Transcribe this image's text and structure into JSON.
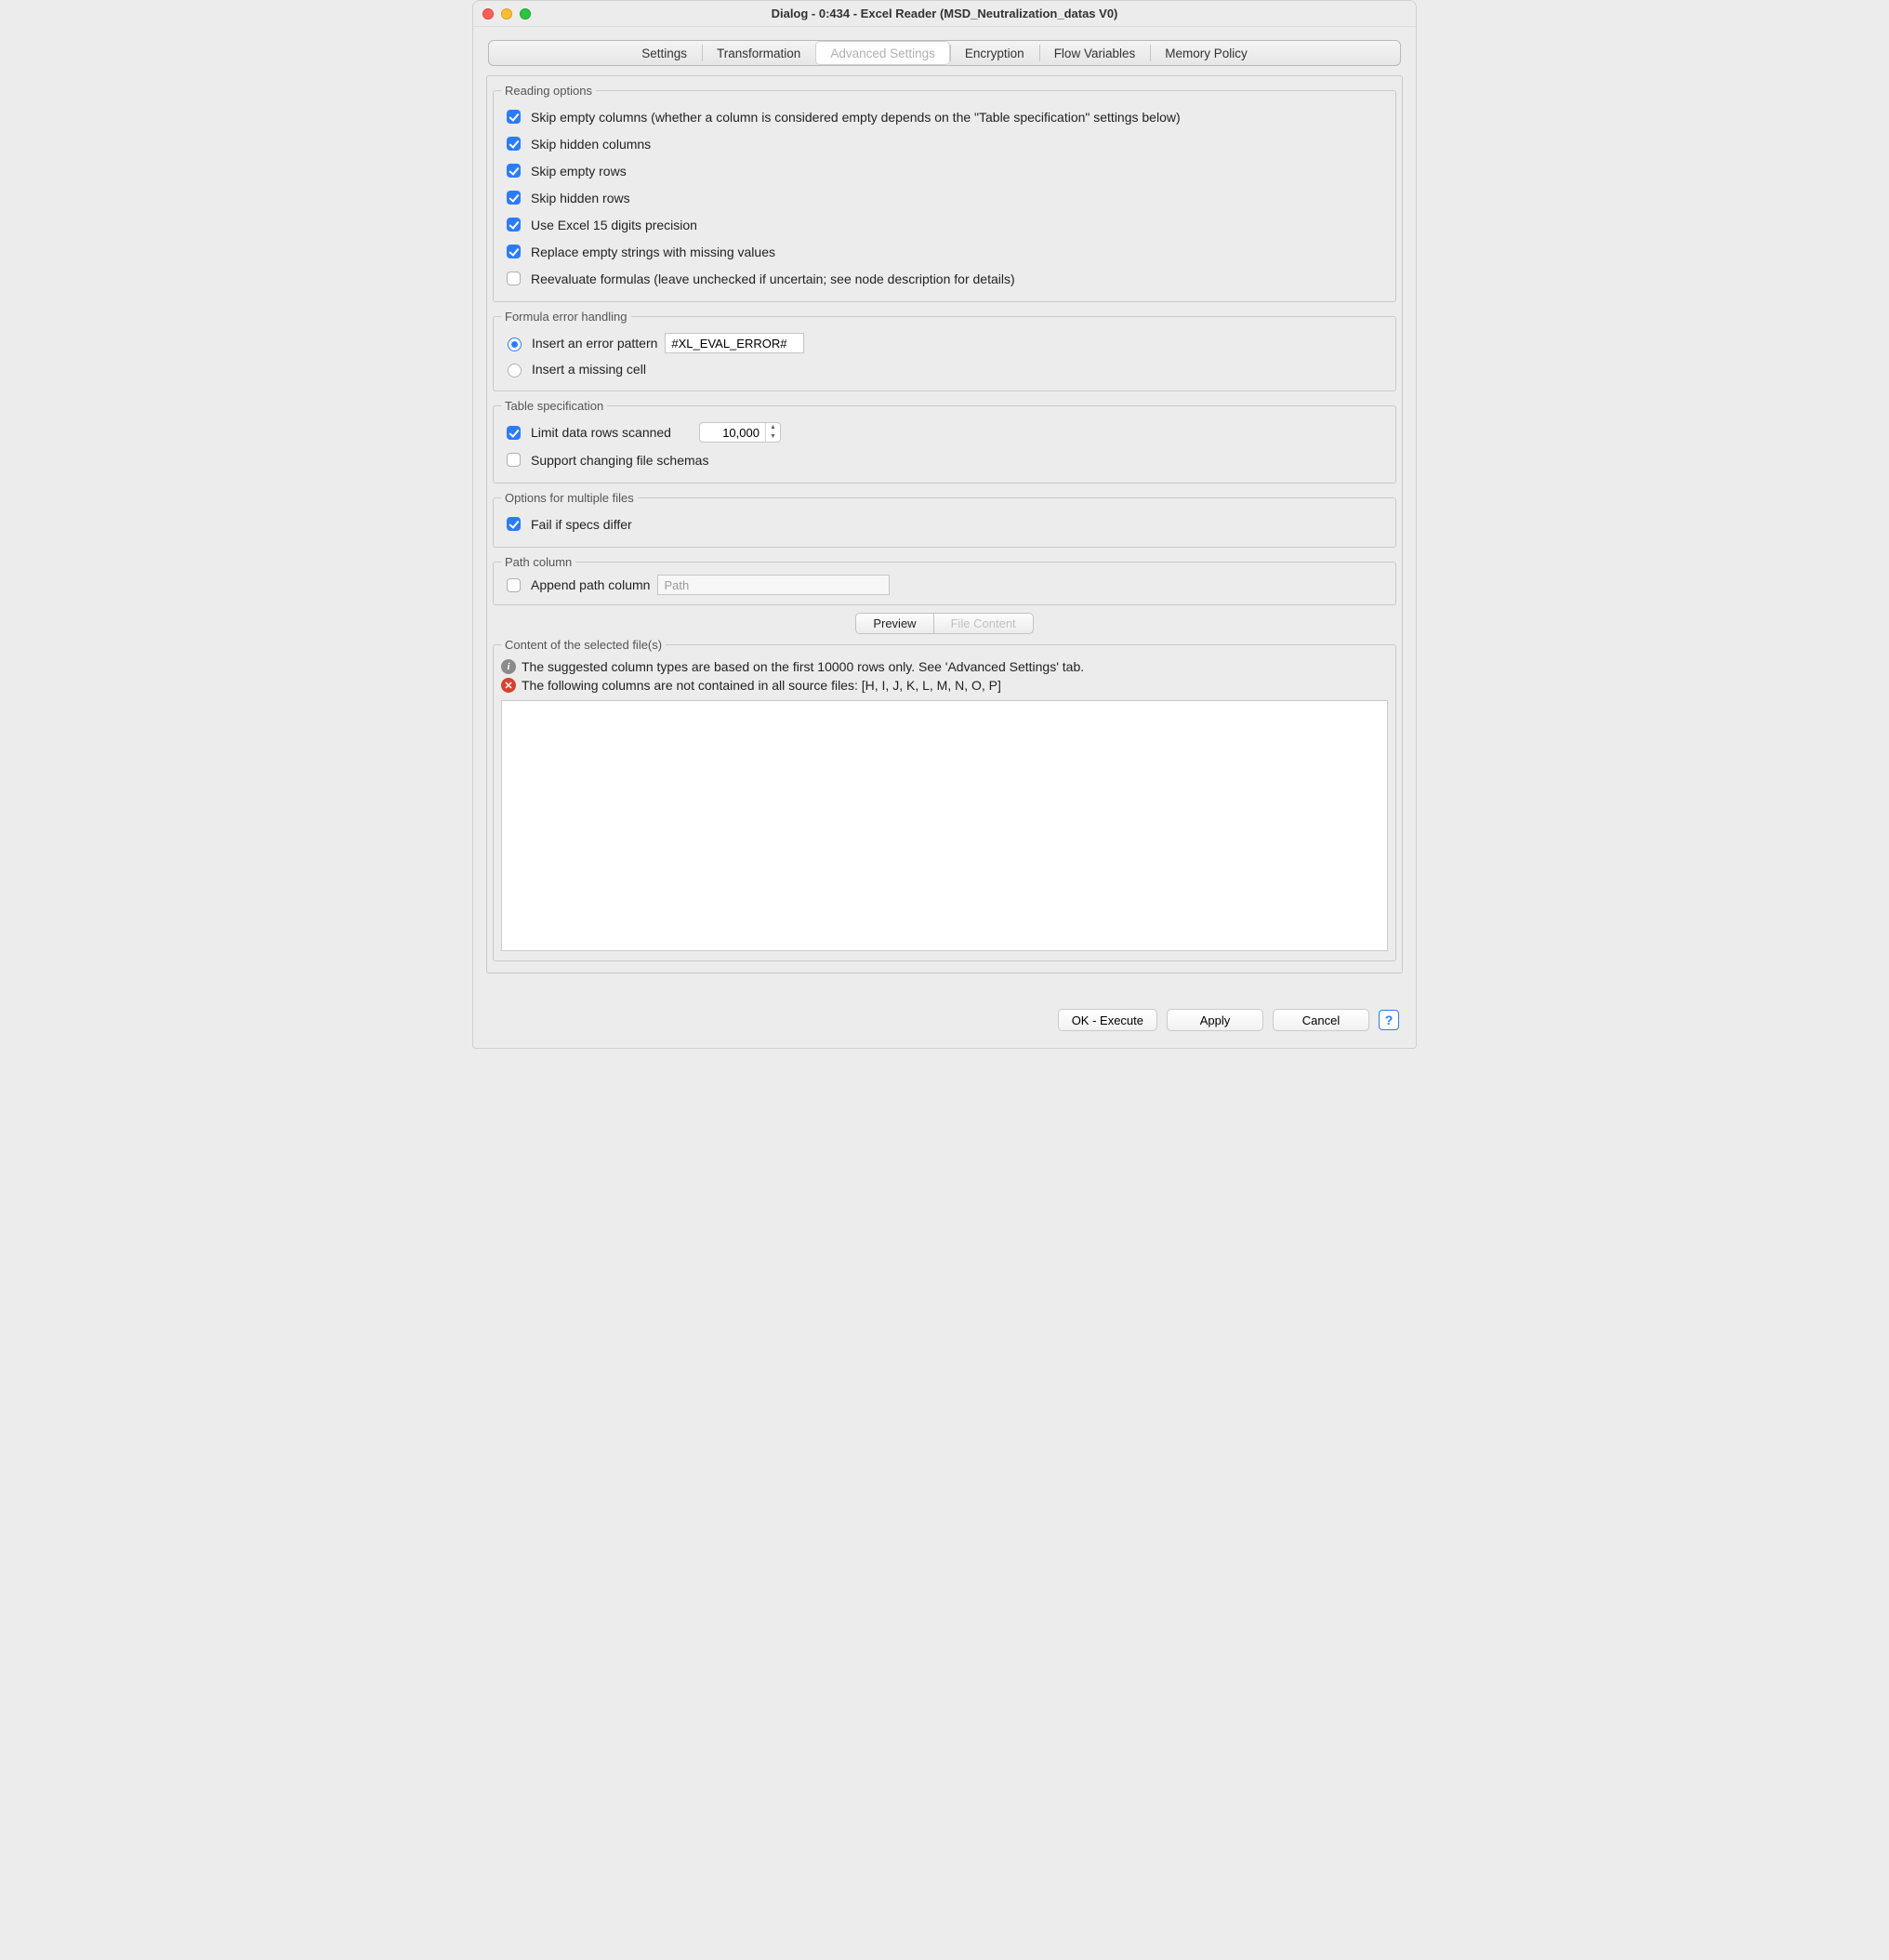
{
  "window": {
    "title": "Dialog - 0:434 - Excel Reader (MSD_Neutralization_datas V0)"
  },
  "tabs": {
    "items": [
      {
        "label": "Settings"
      },
      {
        "label": "Transformation"
      },
      {
        "label": "Advanced Settings"
      },
      {
        "label": "Encryption"
      },
      {
        "label": "Flow Variables"
      },
      {
        "label": "Memory Policy"
      }
    ],
    "selected_index": 2
  },
  "reading_options": {
    "legend": "Reading options",
    "skip_empty_cols": {
      "checked": true,
      "label": "Skip empty columns (whether a column is considered empty depends on the \"Table specification\" settings below)"
    },
    "skip_hidden_cols": {
      "checked": true,
      "label": "Skip hidden columns"
    },
    "skip_empty_rows": {
      "checked": true,
      "label": "Skip empty rows"
    },
    "skip_hidden_rows": {
      "checked": true,
      "label": "Skip hidden rows"
    },
    "excel_15_digits": {
      "checked": true,
      "label": "Use Excel 15 digits precision"
    },
    "replace_empty_strings": {
      "checked": true,
      "label": "Replace empty strings with missing values"
    },
    "reevaluate_formulas": {
      "checked": false,
      "label": "Reevaluate formulas (leave unchecked if uncertain; see node description for details)"
    }
  },
  "formula_error": {
    "legend": "Formula error handling",
    "insert_error_pattern": {
      "label": "Insert an error pattern",
      "value": "#XL_EVAL_ERROR#"
    },
    "insert_missing_cell": {
      "label": "Insert a missing cell"
    },
    "selected": "insert_error_pattern"
  },
  "table_spec": {
    "legend": "Table specification",
    "limit_rows": {
      "checked": true,
      "label": "Limit data rows scanned",
      "value": "10,000"
    },
    "support_changing": {
      "checked": false,
      "label": "Support changing file schemas"
    }
  },
  "multi_files": {
    "legend": "Options for multiple files",
    "fail_if_differ": {
      "checked": true,
      "label": "Fail if specs differ"
    }
  },
  "path_column": {
    "legend": "Path column",
    "append": {
      "checked": false,
      "label": "Append path column",
      "placeholder": "Path"
    }
  },
  "preview_toggle": {
    "preview": "Preview",
    "file_content": "File Content"
  },
  "preview_group": {
    "legend": "Content of the selected file(s)",
    "info_msg": "The suggested column types are based on the first 10000 rows only. See 'Advanced Settings' tab.",
    "error_msg": "The following columns are not contained in all source files: [H, I, J, K, L, M, N, O, P]"
  },
  "buttons": {
    "ok": "OK - Execute",
    "apply": "Apply",
    "cancel": "Cancel"
  }
}
